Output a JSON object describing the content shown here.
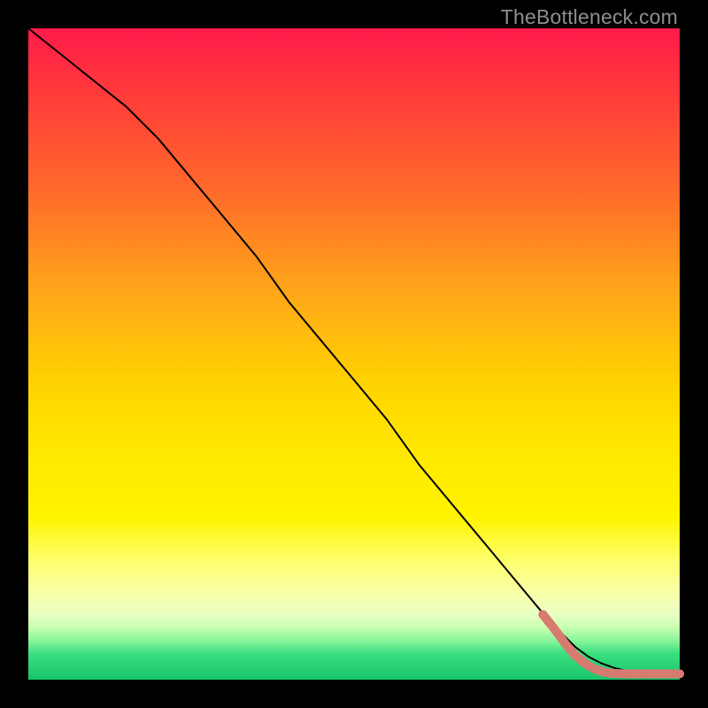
{
  "watermark": "TheBottleneck.com",
  "colors": {
    "curve": "#000000",
    "markers": "#d77b71",
    "gradient_top": "#ff1a4a",
    "gradient_bottom": "#18c46a",
    "frame": "#000000"
  },
  "chart_data": {
    "type": "line",
    "title": "",
    "xlabel": "",
    "ylabel": "",
    "xlim": [
      0,
      100
    ],
    "ylim": [
      0,
      100
    ],
    "axes_visible": false,
    "background": "vertical gradient red→yellow→green",
    "series": [
      {
        "name": "curve",
        "style": "solid-black",
        "x": [
          0,
          5,
          10,
          15,
          20,
          25,
          30,
          35,
          40,
          45,
          50,
          55,
          60,
          65,
          70,
          75,
          80,
          82,
          84,
          86,
          88,
          90,
          92,
          94,
          96,
          98,
          100
        ],
        "y": [
          100,
          96,
          92,
          88,
          83,
          77,
          71,
          65,
          58,
          52,
          46,
          40,
          33,
          27,
          21,
          15,
          9,
          7,
          5,
          3.5,
          2.5,
          1.8,
          1.3,
          1.0,
          0.9,
          0.9,
          0.9
        ]
      },
      {
        "name": "markers",
        "style": "scatter-salmon",
        "x": [
          79,
          79.8,
          80.6,
          81.2,
          81.8,
          82.3,
          82.8,
          83.2,
          83.6,
          84.0,
          85.3,
          86.8,
          88.2,
          89.2,
          91.2,
          92.5,
          93.6,
          94.5,
          95.3,
          97.2,
          98.5,
          100
        ],
        "y": [
          10.0,
          9.0,
          8.0,
          7.2,
          6.4,
          5.7,
          5.1,
          4.6,
          4.1,
          3.7,
          2.6,
          1.7,
          1.2,
          1.0,
          0.9,
          0.9,
          0.9,
          0.9,
          0.9,
          0.9,
          0.9,
          0.9
        ]
      }
    ]
  }
}
